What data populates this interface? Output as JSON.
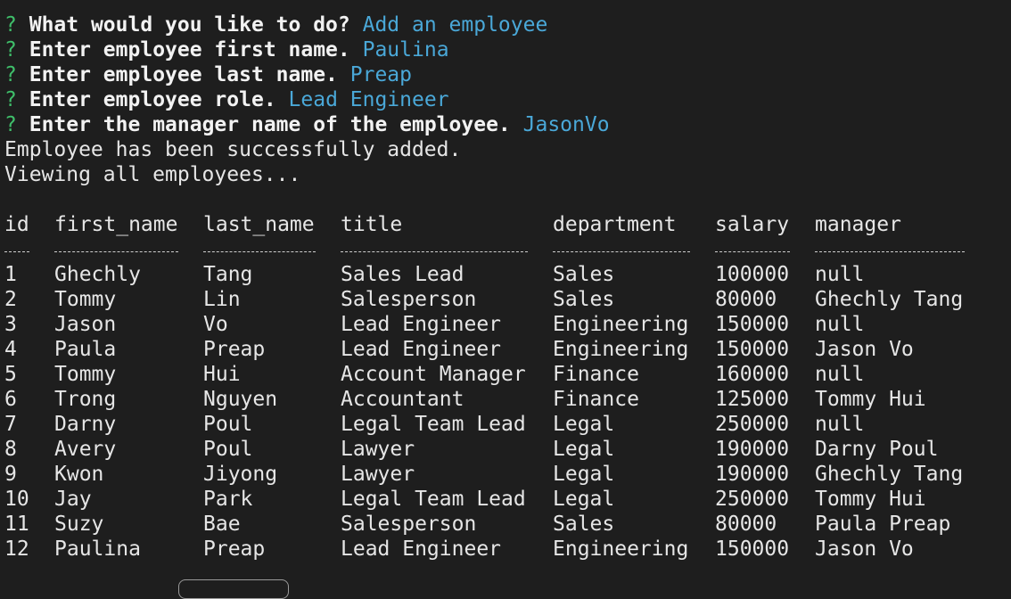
{
  "prompts": [
    {
      "marker": "?",
      "question": "What would you like to do?",
      "answer": "Add an employee"
    },
    {
      "marker": "?",
      "question": "Enter employee first name.",
      "answer": "Paulina"
    },
    {
      "marker": "?",
      "question": "Enter employee last name.",
      "answer": "Preap"
    },
    {
      "marker": "?",
      "question": "Enter employee role.",
      "answer": "Lead Engineer"
    },
    {
      "marker": "?",
      "question": "Enter the manager name of the employee.",
      "answer": "JasonVo"
    }
  ],
  "messages": {
    "success": "Employee has been successfully added.",
    "viewing": "Viewing all employees..."
  },
  "table": {
    "headers": [
      "id",
      "first_name",
      "last_name",
      "title",
      "department",
      "salary",
      "manager"
    ],
    "rows": [
      [
        "1",
        "Ghechly",
        "Tang",
        "Sales Lead",
        "Sales",
        "100000",
        "null"
      ],
      [
        "2",
        "Tommy",
        "Lin",
        "Salesperson",
        "Sales",
        "80000",
        "Ghechly Tang"
      ],
      [
        "3",
        "Jason",
        "Vo",
        "Lead Engineer",
        "Engineering",
        "150000",
        "null"
      ],
      [
        "4",
        "Paula",
        "Preap",
        "Lead Engineer",
        "Engineering",
        "150000",
        "Jason Vo"
      ],
      [
        "5",
        "Tommy",
        "Hui",
        "Account Manager",
        "Finance",
        "160000",
        "null"
      ],
      [
        "6",
        "Trong",
        "Nguyen",
        "Accountant",
        "Finance",
        "125000",
        "Tommy Hui"
      ],
      [
        "7",
        "Darny",
        "Poul",
        "Legal Team Lead",
        "Legal",
        "250000",
        "null"
      ],
      [
        "8",
        "Avery",
        "Poul",
        "Lawyer",
        "Legal",
        "190000",
        "Darny Poul"
      ],
      [
        "9",
        "Kwon",
        "Jiyong",
        "Lawyer",
        "Legal",
        "190000",
        "Ghechly Tang"
      ],
      [
        "10",
        "Jay",
        "Park",
        "Legal Team Lead",
        "Legal",
        "250000",
        "Tommy Hui"
      ],
      [
        "11",
        "Suzy",
        "Bae",
        "Salesperson",
        "Sales",
        "80000",
        "Paula Preap"
      ],
      [
        "12",
        "Paulina",
        "Preap",
        "Lead Engineer",
        "Engineering",
        "150000",
        "Jason Vo"
      ]
    ]
  },
  "colors": {
    "background": "#1e1e1e",
    "prompt_marker": "#3fbf6a",
    "answer": "#4aa8d8",
    "text": "#e6e6e6"
  }
}
